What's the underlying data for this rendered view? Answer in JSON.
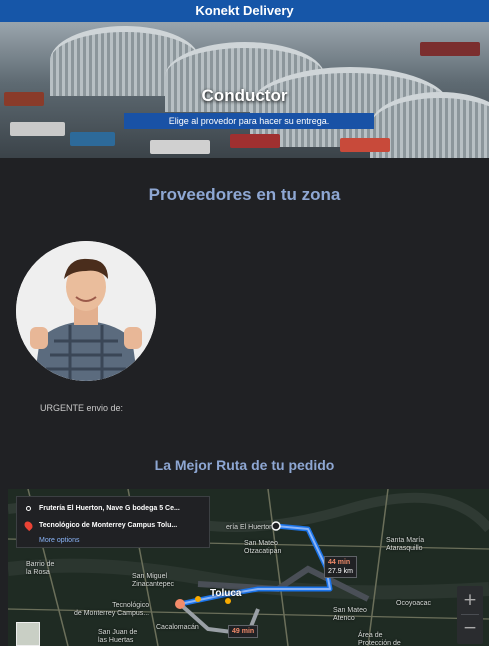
{
  "header": {
    "brand": "Konekt Delivery"
  },
  "hero": {
    "title": "Conductor",
    "subtitle": "Elige al provedor para hacer su entrega."
  },
  "providers": {
    "heading": "Proveedores en tu zona",
    "urgent_text": "URGENTE envio de:"
  },
  "route": {
    "heading": "La Mejor Ruta de tu pedido"
  },
  "map": {
    "origin": "Frutería El Huerton, Nave G bodega 5 Ce...",
    "destination": "Tecnológico de Monterrey Campus Tolu...",
    "more_options": "More options",
    "labels": {
      "huerton": "ería El Huerton",
      "otzacatipan": "San Mateo\nOtzacatipan",
      "santa_maria": "Santa María\nAtarasquillo",
      "barrio": "Barrio de\nla Rosa",
      "zinacantepec": "San Miguel\nZinacantepec",
      "toluca": "Toluca",
      "tec": "Tecnológico\nde Monterrey Campus...",
      "cacalomacan": "Cacalomacán",
      "juan": "San Juan de\nlas Huertas",
      "ocoyoacac": "Ocoyoacac",
      "atenco": "San Mateo\nAtenco",
      "area": "Área de\nProtección de"
    },
    "eta_primary": {
      "time": "44 min",
      "distance": "27.9 km"
    },
    "eta_secondary": {
      "time": "49 min"
    },
    "zoom_in": "+",
    "zoom_out": "−"
  }
}
